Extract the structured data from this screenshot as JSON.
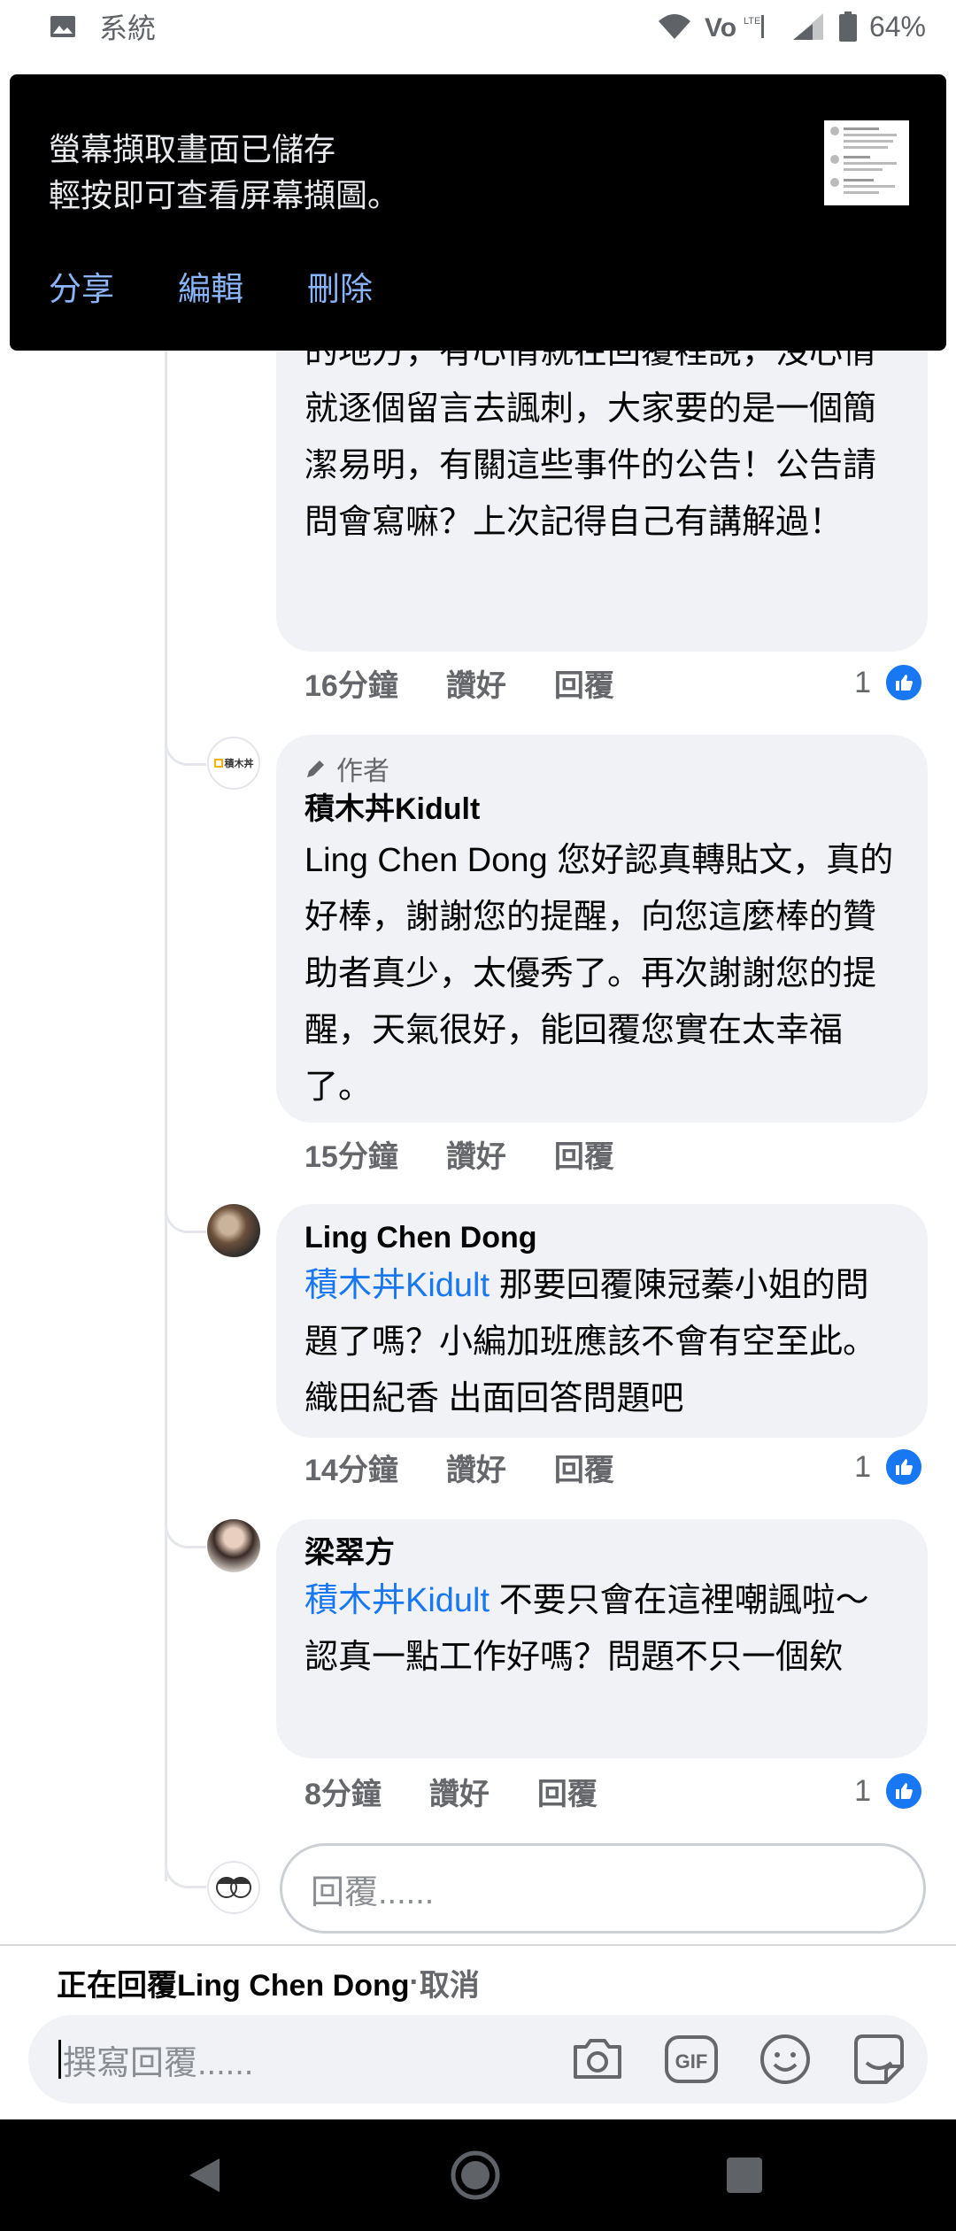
{
  "status_bar": {
    "label": "系統",
    "battery": "64%"
  },
  "notification": {
    "title": "螢幕擷取畫面已儲存",
    "subtitle": "輕按即可查看屏幕擷圖。",
    "actions": [
      "分享",
      "編輯",
      "刪除"
    ]
  },
  "comments": [
    {
      "text": "的地方，有心情就在回覆裡說，沒心情就逐個留言去諷刺，大家要的是一個簡潔易明，有關這些事件的公告！公告請問會寫嘛？上次記得自己有講解過！",
      "time": "16分鐘",
      "like": "讚好",
      "reply": "回覆",
      "like_count": "1"
    },
    {
      "author_badge": "作者",
      "avatar_text": "積木丼",
      "name": "積木丼Kidult",
      "text": "Ling Chen Dong 您好認真轉貼文，真的好棒，謝謝您的提醒，向您這麼棒的贊助者真少，太優秀了。再次謝謝您的提醒，天氣很好，能回覆您實在太幸福了。",
      "time": "15分鐘",
      "like": "讚好",
      "reply": "回覆"
    },
    {
      "name": "Ling Chen Dong",
      "mention": "積木丼Kidult",
      "text": " 那要回覆陳冠蓁小姐的問題了嗎？小編加班應該不會有空至此。 織田紀香 出面回答問題吧",
      "time": "14分鐘",
      "like": "讚好",
      "reply": "回覆",
      "like_count": "1"
    },
    {
      "name": "梁翠方",
      "mention": "積木丼Kidult",
      "text": " 不要只會在這裡嘲諷啦～認真一點工作好嗎？問題不只一個欸",
      "time": "8分鐘",
      "like": "讚好",
      "reply": "回覆",
      "like_count": "1"
    }
  ],
  "reply_box": {
    "placeholder": "回覆......"
  },
  "replying_bar": {
    "text": "正在回覆Ling Chen Dong",
    "sep": " · ",
    "cancel": "取消"
  },
  "compose": {
    "placeholder": "撰寫回覆......",
    "gif_label": "GIF"
  },
  "icons": {
    "status": [
      "image-icon",
      "wifi-icon",
      "volte-icon",
      "signal-icon",
      "battery-icon"
    ],
    "compose": [
      "camera-icon",
      "gif-icon",
      "emoji-icon",
      "sticker-icon"
    ],
    "nav": [
      "back-icon",
      "home-icon",
      "recents-icon"
    ]
  },
  "colors": {
    "link": "#1877f2",
    "bubble": "#f0f2f5",
    "notification_bg": "#000000",
    "notification_action": "#8ab4f8"
  }
}
